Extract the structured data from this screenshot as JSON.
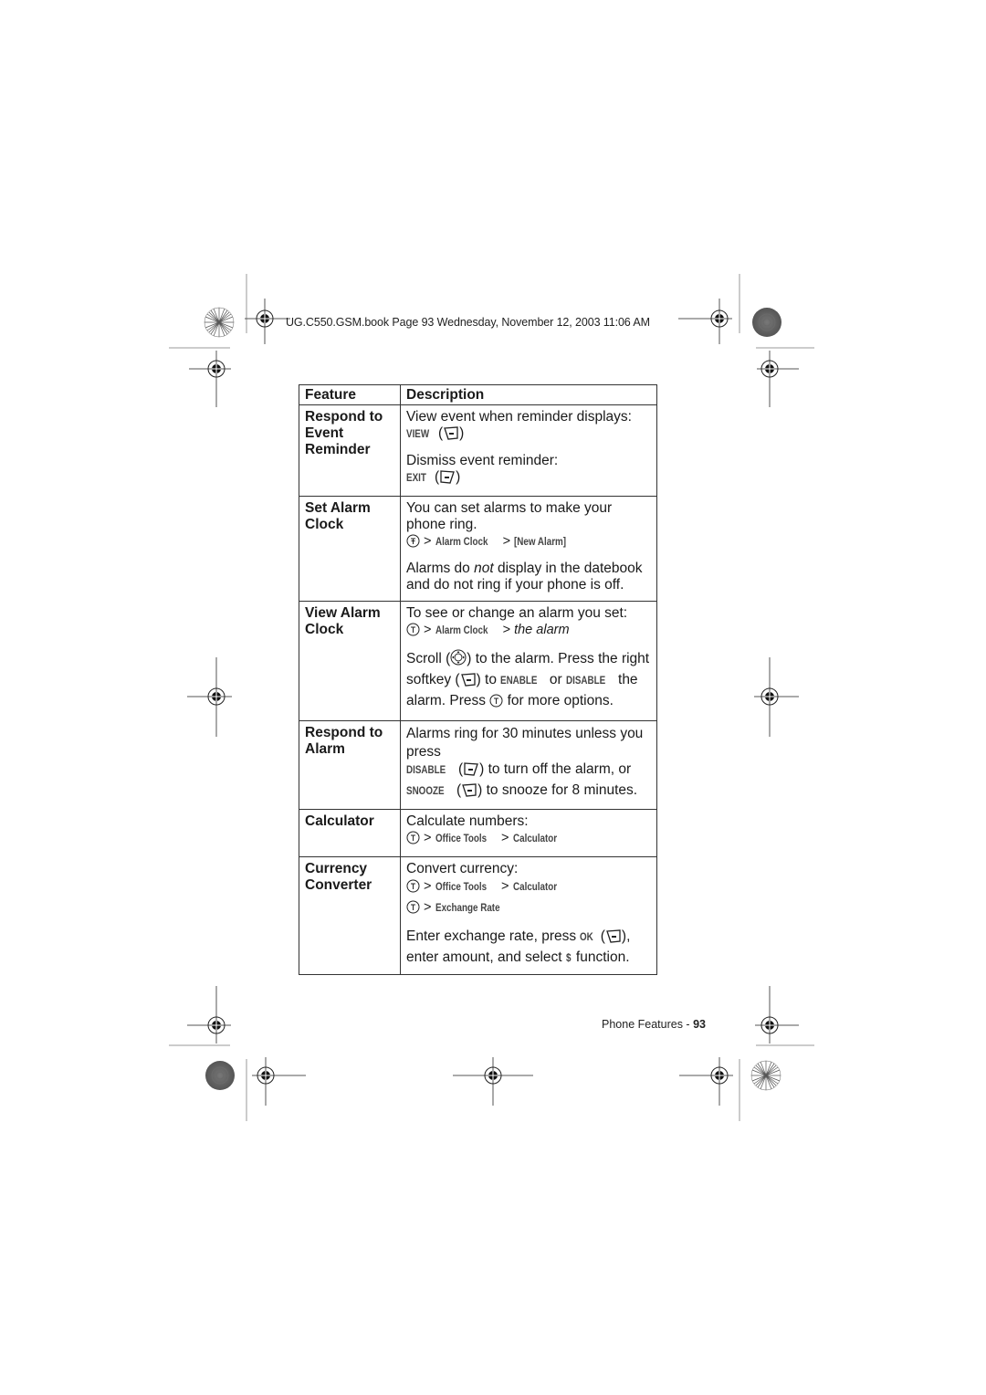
{
  "header": {
    "running_head": "UG.C550.GSM.book  Page 93  Wednesday, November 12, 2003  11:06 AM"
  },
  "table": {
    "columns": [
      "Feature",
      "Description"
    ],
    "rows": [
      {
        "feature": "Respond to Event Reminder",
        "desc": {
          "l1": "View event when reminder displays:",
          "view_cmd": "VIEW",
          "l2": "Dismiss event reminder:",
          "exit_cmd": "EXIT"
        }
      },
      {
        "feature": "Set Alarm Clock",
        "desc": {
          "l1": "You can set alarms to make your phone ring.",
          "path1": "Alarm Clock",
          "path2": "[New Alarm]",
          "l2a": "Alarms do ",
          "l2_em": "not",
          "l2b": " display in the datebook and do not ring if your phone is off."
        }
      },
      {
        "feature": "View Alarm Clock",
        "desc": {
          "l1": "To see or change an alarm you set:",
          "path1": "Alarm Clock",
          "path_em": "the alarm",
          "s1": "Scroll (",
          "s2": ") to the alarm. Press the right softkey (",
          "s3": ") to ",
          "enable_cmd": "ENABLE",
          "s4": " or ",
          "disable_cmd": "DISABLE",
          "s5": " the alarm. Press ",
          "s6": " for more options."
        }
      },
      {
        "feature": "Respond to Alarm",
        "desc": {
          "l1": "Alarms ring for 30 minutes unless you press",
          "disable_cmd": "DISABLE",
          "t1": ") to turn off the alarm, or",
          "snooze_cmd": "SNOOZE",
          "t2": ") to snooze for 8 minutes."
        }
      },
      {
        "feature": "Calculator",
        "desc": {
          "l1": "Calculate numbers:",
          "path1": "Office Tools",
          "path2": "Calculator"
        }
      },
      {
        "feature": "Currency Converter",
        "desc": {
          "l1": "Convert currency:",
          "path1": "Office Tools",
          "path2": "Calculator",
          "path3": "Exchange Rate",
          "e1": "Enter exchange rate, press ",
          "ok_cmd": "OK",
          "e2": "),",
          "e3": "enter amount, and select ",
          "dollar_cmd": "$",
          "e4": " function."
        }
      }
    ]
  },
  "icons": {
    "menu_key": "menu-key-icon",
    "right_softkey": "right-softkey-icon",
    "left_softkey": "left-softkey-icon",
    "nav_key": "navigation-key-icon"
  },
  "symbols": {
    "gt": ">",
    "open_paren": "(",
    "close_paren": ")"
  },
  "footer": {
    "section": "Phone Features - ",
    "page": "93"
  }
}
